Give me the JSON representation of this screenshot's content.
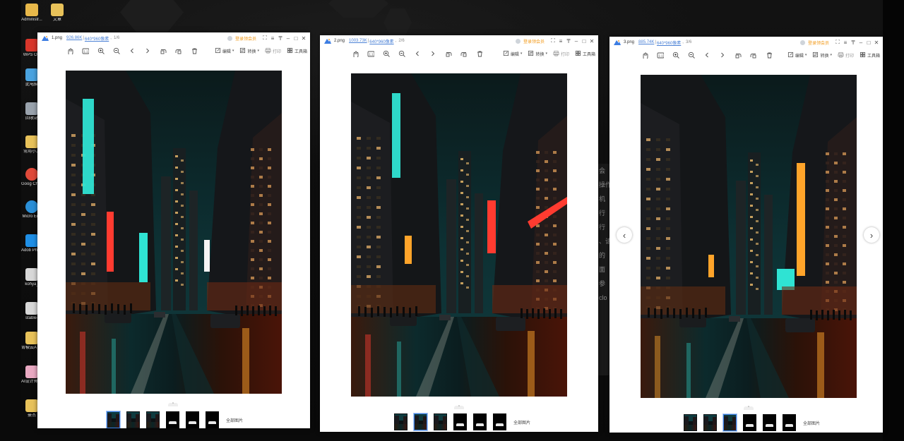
{
  "desktop": {
    "icons": [
      {
        "label": "Administr...",
        "icon": "user-folder-icon",
        "color": "#e8b84a"
      },
      {
        "label": "文章",
        "icon": "folder-icon",
        "color": "#e8c25a"
      },
      {
        "label": "WPS Offi",
        "icon": "wps-office-icon",
        "color": "#d9362b"
      },
      {
        "label": "此电脑",
        "icon": "computer-icon",
        "color": "#4aa3e0"
      },
      {
        "label": "回收站",
        "icon": "recycle-bin-icon",
        "color": "#9aa3ad"
      },
      {
        "label": "常用小工",
        "icon": "folder-icon",
        "color": "#e8c25a"
      },
      {
        "label": "Goog Chrom",
        "icon": "chrome-icon",
        "color": "#e04a3a"
      },
      {
        "label": "Micro Edg",
        "icon": "edge-icon",
        "color": "#2a8fd8"
      },
      {
        "label": "Adob Photos",
        "icon": "photoshop-icon",
        "color": "#1f8fe6"
      },
      {
        "label": "kohya_",
        "icon": "shortcut-icon",
        "color": "#d8d8d8"
      },
      {
        "label": "stable-",
        "icon": "shortcut-icon",
        "color": "#d8d8d8"
      },
      {
        "label": "青椒云A 专区-使",
        "icon": "folder-icon",
        "color": "#e8c25a"
      },
      {
        "label": "AI设计师 - 快捷方",
        "icon": "anime-avatar-icon",
        "color": "#e9a9c2"
      },
      {
        "label": "豪杰",
        "icon": "folder-icon",
        "color": "#e8c25a"
      }
    ],
    "background_window_text": [
      "会",
      "操作",
      "机",
      "行",
      "行",
      "、请",
      "的",
      "面",
      "参",
      "clo"
    ]
  },
  "viewers": [
    {
      "filename": "1.png",
      "size": "926.86K",
      "dims": "640*960像素",
      "index": "1/6",
      "vip_label": "登录领会员",
      "toolbar": {
        "edit": "编辑",
        "convert": "转换",
        "print": "打印",
        "tools": "工具箱"
      },
      "thumbs_selected": 0,
      "all_label": "全部图片"
    },
    {
      "filename": "2.png",
      "size": "1003.73K",
      "dims": "640*960像素",
      "index": "2/6",
      "vip_label": "登录领会员",
      "toolbar": {
        "edit": "编辑",
        "convert": "转换",
        "print": "打印",
        "tools": "工具箱"
      },
      "thumbs_selected": 1,
      "all_label": "全部图片"
    },
    {
      "filename": "3.png",
      "size": "885.74K",
      "dims": "640*960像素",
      "index": "3/6",
      "vip_label": "登录领会员",
      "toolbar": {
        "edit": "编辑",
        "convert": "转换",
        "print": "打印",
        "tools": "工具箱"
      },
      "thumbs_selected": 2,
      "all_label": "全部图片"
    }
  ],
  "colors": {
    "accent": "#3b7ee0",
    "vip": "#f29a1a",
    "link": "#4c82d6",
    "neon_teal": "#2fe3d3",
    "neon_red": "#ff3b30",
    "neon_orange": "#ffa42a"
  }
}
